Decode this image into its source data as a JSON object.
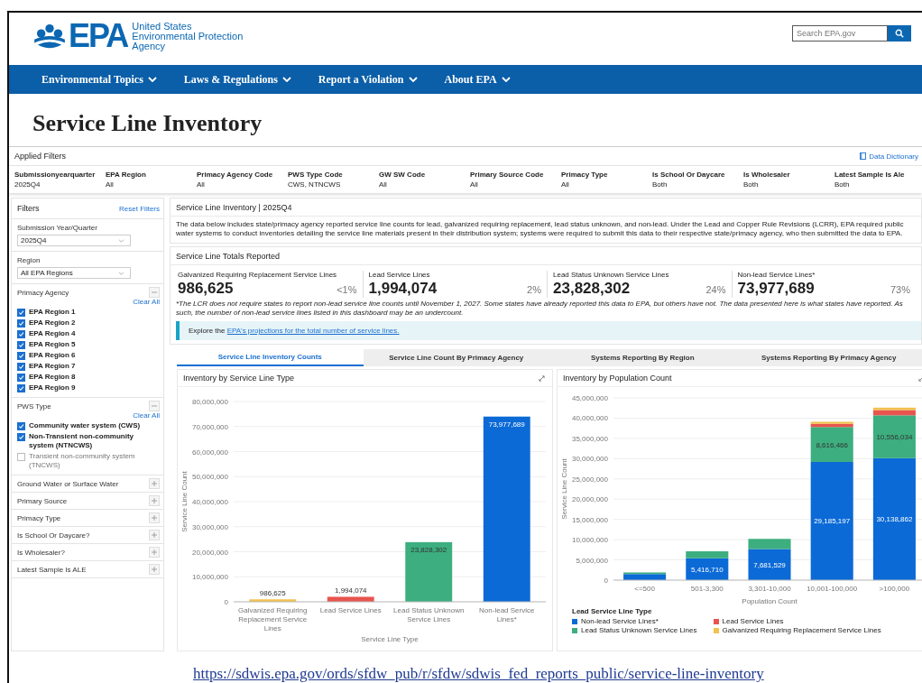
{
  "header": {
    "logo": {
      "acronym": "EPA",
      "agency_lines": [
        "United States",
        "Environmental Protection",
        "Agency"
      ]
    },
    "search": {
      "placeholder": "Search EPA.gov"
    }
  },
  "nav": [
    "Environmental Topics",
    "Laws & Regulations",
    "Report a Violation",
    "About EPA"
  ],
  "page_title": "Service Line Inventory",
  "applied_filters": {
    "title": "Applied Filters",
    "link": "Data Dictionary",
    "filters": [
      {
        "label": "Submissionyearquarter",
        "value": "2025Q4"
      },
      {
        "label": "EPA Region",
        "value": "All"
      },
      {
        "label": "Primacy Agency Code",
        "value": "All"
      },
      {
        "label": "PWS Type Code",
        "value": "CWS, NTNCWS"
      },
      {
        "label": "GW SW Code",
        "value": "All"
      },
      {
        "label": "Primary Source Code",
        "value": "All"
      },
      {
        "label": "Primacy Type",
        "value": "All"
      },
      {
        "label": "Is School Or Daycare",
        "value": "Both"
      },
      {
        "label": "Is Wholesaler",
        "value": "Both"
      },
      {
        "label": "Latest Sample Is Ale",
        "value": "Both"
      }
    ]
  },
  "sidebar": {
    "title": "Filters",
    "reset": "Reset Filters",
    "selects": [
      {
        "label": "Submission Year/Quarter",
        "value": "2025Q4"
      },
      {
        "label": "Region",
        "value": "All EPA Regions"
      }
    ],
    "sections": [
      {
        "label": "Primacy Agency",
        "expanded": true,
        "clear": "Clear All",
        "options": [
          {
            "label": "EPA Region 1",
            "checked": true
          },
          {
            "label": "EPA Region 2",
            "checked": true
          },
          {
            "label": "EPA Region 4",
            "checked": true
          },
          {
            "label": "EPA Region 5",
            "checked": true
          },
          {
            "label": "EPA Region 6",
            "checked": true
          },
          {
            "label": "EPA Region 7",
            "checked": true
          },
          {
            "label": "EPA Region 8",
            "checked": true
          },
          {
            "label": "EPA Region 9",
            "checked": true
          }
        ]
      },
      {
        "label": "PWS Type",
        "expanded": true,
        "clear": "Clear All",
        "options": [
          {
            "label": "Community water system (CWS)",
            "checked": true
          },
          {
            "label": "Non-Transient non-community system (NTNCWS)",
            "checked": true
          },
          {
            "label": "Transient non-community system (TNCWS)",
            "checked": false
          }
        ]
      },
      {
        "label": "Ground Water or Surface Water",
        "expanded": false
      },
      {
        "label": "Primary Source",
        "expanded": false
      },
      {
        "label": "Primacy Type",
        "expanded": false
      },
      {
        "label": "Is School Or Daycare?",
        "expanded": false
      },
      {
        "label": "Is Wholesaler?",
        "expanded": false
      },
      {
        "label": "Latest Sample Is ALE",
        "expanded": false
      }
    ]
  },
  "intro": {
    "title": "Service Line Inventory | 2025Q4",
    "text": "The data below includes state/primacy agency reported service line counts for lead, galvanized requiring replacement, lead status unknown, and non-lead. Under the Lead and Copper Rule Revisions (LCRR), EPA required public water systems to conduct inventories detailing the service line materials present in their distribution system; systems were required to submit this data to their respective state/primacy agency, who then submitted the data to EPA."
  },
  "totals": {
    "title": "Service Line Totals Reported",
    "stats": [
      {
        "label": "Galvanized Requiring Replacement Service Lines",
        "value": "986,625",
        "share": "<1%"
      },
      {
        "label": "Lead Service Lines",
        "value": "1,994,074",
        "share": "2%"
      },
      {
        "label": "Lead Status Unknown Service Lines",
        "value": "23,828,302",
        "share": "24%"
      },
      {
        "label": "Non-lead Service Lines*",
        "value": "73,977,689",
        "share": "73%"
      }
    ],
    "footnote": "*The LCR does not require states to report non-lead service line counts until November 1, 2027. Some states have already reported this data to EPA, but others have not. The data presented here is what states have reported. As such, the number of non-lead service lines listed in this dashboard may be an undercount.",
    "callout": {
      "text": "Explore the ",
      "link": "EPA's projections for the total number of service lines."
    }
  },
  "tabs": [
    {
      "label": "Service Line Inventory Counts",
      "selected": true
    },
    {
      "label": "Service Line Count By Primacy Agency",
      "selected": false
    },
    {
      "label": "Systems Reporting By Region",
      "selected": false
    },
    {
      "label": "Systems Reporting By Primacy Agency",
      "selected": false
    }
  ],
  "charts": [
    {
      "title": "Inventory by Service Line Type",
      "chart_data": {
        "type": "bar",
        "xlabel": "Service Line Type",
        "ylabel": "Service Line Count",
        "categories": [
          "Galvanized Requiring Replacement Service Lines",
          "Lead Service Lines",
          "Lead Status Unknown Service Lines",
          "Non-lead Service Lines*"
        ],
        "grid": true,
        "values": [
          986625,
          1994074,
          23828302,
          73977689
        ],
        "colors": [
          "#f2c14e",
          "#e8554e",
          "#3cae7f",
          "#0b6ad6"
        ],
        "ylim": [
          0,
          80000000
        ],
        "yticks": [
          {
            "value": 0,
            "label": "0"
          },
          {
            "value": 10000000,
            "label": "10,000,000"
          },
          {
            "value": 20000000,
            "label": "20,000,000"
          },
          {
            "value": 30000000,
            "label": "30,000,000"
          },
          {
            "value": 40000000,
            "label": "40,000,000"
          },
          {
            "value": 50000000,
            "label": "50,000,000"
          },
          {
            "value": 60000000,
            "label": "60,000,000"
          },
          {
            "value": 70000000,
            "label": "70,000,000"
          },
          {
            "value": 80000000,
            "label": "80,000,000"
          }
        ],
        "value_labels": [
          "986,625",
          "1,994,074",
          "23,828,302",
          "73,977,689"
        ]
      }
    },
    {
      "title": "Inventory by Population Count",
      "legend_title": "Lead Service Line Type",
      "chart_data": {
        "type": "bar",
        "stacked": true,
        "xlabel": "Population Count",
        "ylabel": "Service Line Count",
        "categories": [
          "<=500",
          "501-3,300",
          "3,301-10,000",
          "10,001-100,000",
          ">100,000"
        ],
        "series": [
          {
            "name": "Non-lead Service Lines*",
            "color": "#0b6ad6",
            "values": [
              1500000,
              5416710,
              7681529,
              29185197,
              30138862
            ]
          },
          {
            "name": "Lead Status Unknown Service Lines",
            "color": "#3cae7f",
            "values": [
              400000,
              1700000,
              2500000,
              8616466,
              10556034
            ]
          },
          {
            "name": "Lead Service Lines",
            "color": "#e8554e",
            "values": [
              null,
              null,
              null,
              800000,
              1300000
            ]
          },
          {
            "name": "Galvanized Requiring Replacement Service Lines",
            "color": "#f2c14e",
            "values": [
              null,
              null,
              null,
              500000,
              600000
            ]
          }
        ],
        "grid": true,
        "ylim": [
          0,
          45000000
        ],
        "yticks": [
          {
            "value": 0,
            "label": "0"
          },
          {
            "value": 5000000,
            "label": "5,000,000"
          },
          {
            "value": 10000000,
            "label": "10,000,000"
          },
          {
            "value": 15000000,
            "label": "15,000,000"
          },
          {
            "value": 20000000,
            "label": "20,000,000"
          },
          {
            "value": 25000000,
            "label": "25,000,000"
          },
          {
            "value": 30000000,
            "label": "30,000,000"
          },
          {
            "value": 35000000,
            "label": "35,000,000"
          },
          {
            "value": 40000000,
            "label": "40,000,000"
          },
          {
            "value": 45000000,
            "label": "45,000,000"
          }
        ],
        "value_labels": [
          [
            null,
            "5,416,710",
            "7,681,529",
            "29,185,197",
            "30,138,862"
          ],
          [
            null,
            null,
            null,
            "8,616,466",
            "10,556,034"
          ],
          [
            null,
            null,
            null,
            null,
            null
          ],
          [
            null,
            null,
            null,
            null,
            null
          ]
        ]
      }
    }
  ],
  "source_url": "https://sdwis.epa.gov/ords/sfdw_pub/r/sfdw/sdwis_fed_reports_public/service-line-inventory"
}
